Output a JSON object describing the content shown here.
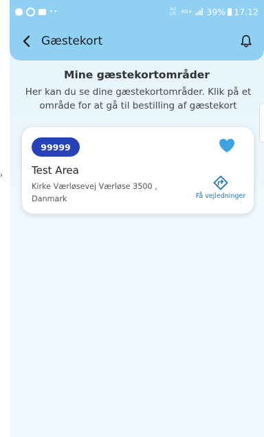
{
  "status_bar": {
    "more_indicator": "··",
    "volte_label": "Vo) LTE",
    "network_label": "4G+",
    "battery": "39%",
    "time": "17.12"
  },
  "navbar": {
    "title": "Gæstekort"
  },
  "section": {
    "title": "Mine gæstekortområder",
    "description": "Her kan du se dine gæstekortområder. Klik på et område for at gå til bestilling af gæstekort"
  },
  "areas": [
    {
      "code": "99999",
      "name": "Test Area",
      "address": "Kirke Værløsevej Værløse 3500 , Danmark",
      "favorite": true,
      "directions_label": "Få vejledninger"
    }
  ],
  "colors": {
    "header": "#90d0f3",
    "badge": "#2741b8",
    "heart": "#3aa3e0",
    "link": "#1d73b4"
  }
}
